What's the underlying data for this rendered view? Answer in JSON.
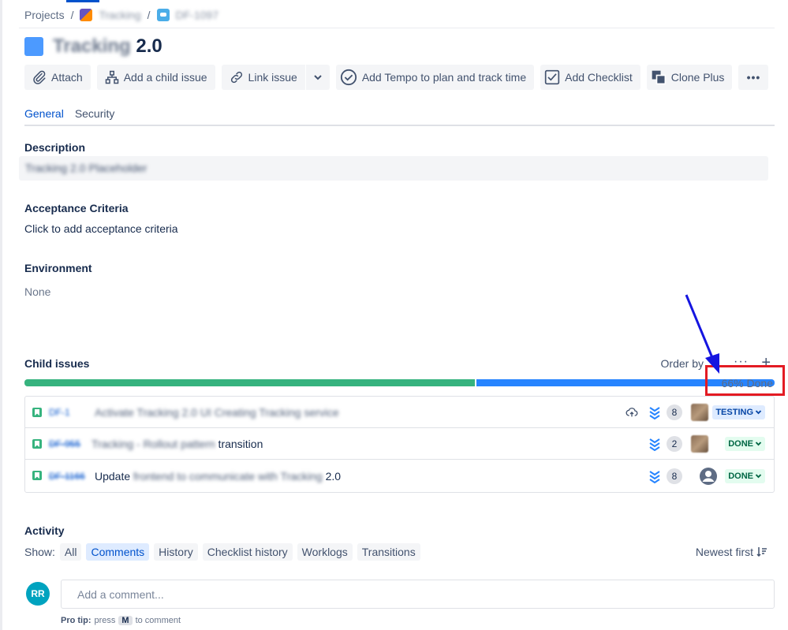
{
  "breadcrumb": {
    "projects": "Projects",
    "separator": "/",
    "project_name": "Tracking",
    "issue_key": "DF-1097"
  },
  "issue": {
    "title_blurred": "Tracking",
    "title_version": " 2.0"
  },
  "toolbar": {
    "attach": "Attach",
    "add_child": "Add a child issue",
    "link_issue": "Link issue",
    "tempo": "Add Tempo to plan and track time",
    "checklist": "Add Checklist",
    "clone_plus": "Clone Plus",
    "more": "•••"
  },
  "tabs": [
    "General",
    "Security"
  ],
  "fields": {
    "description_label": "Description",
    "description_value": "Tracking 2.0 Placeholder",
    "acceptance_label": "Acceptance Criteria",
    "acceptance_value": "Click to add acceptance criteria",
    "environment_label": "Environment",
    "environment_value": "None"
  },
  "child_issues": {
    "title": "Child issues",
    "order_by": "Order by",
    "more": "···",
    "add": "+",
    "percent_done_label": "66% Done",
    "progress": {
      "done_fraction": 0.6
    },
    "rows": [
      {
        "key": "DF-1",
        "summary_blur": "Activate Tracking 2.0 UI Creating Tracking service",
        "summary_tail": "",
        "estimate": "8",
        "status": "TESTING",
        "key_done": false,
        "cloud": true,
        "assignee_type": "photo"
      },
      {
        "key": "DF-955",
        "summary_blur": "Tracking - Rollout pattern",
        "summary_tail": " transition",
        "estimate": "2",
        "status": "DONE",
        "key_done": true,
        "cloud": false,
        "assignee_type": "photo"
      },
      {
        "key": "DF-1166",
        "summary_prefix": "Update",
        "summary_blur": " frontend to communicate with Tracking",
        "summary_tail": " 2.0",
        "estimate": "8",
        "status": "DONE",
        "key_done": true,
        "cloud": false,
        "assignee_type": "default"
      }
    ]
  },
  "activity": {
    "title": "Activity",
    "show_label": "Show:",
    "filters": [
      "All",
      "Comments",
      "History",
      "Checklist history",
      "Worklogs",
      "Transitions"
    ],
    "active_filter": "Comments",
    "sort_label": "Newest first",
    "avatar_initials": "RR",
    "comment_placeholder": "Add a comment...",
    "pro_tip_label": "Pro tip:",
    "pro_tip_press": "press",
    "pro_tip_key": "M",
    "pro_tip_suffix": "to comment"
  },
  "colors": {
    "progress_done": "#36b37e",
    "progress_in_progress": "#2684ff",
    "highlight": "#e31b23",
    "arrow": "#1515e0"
  }
}
